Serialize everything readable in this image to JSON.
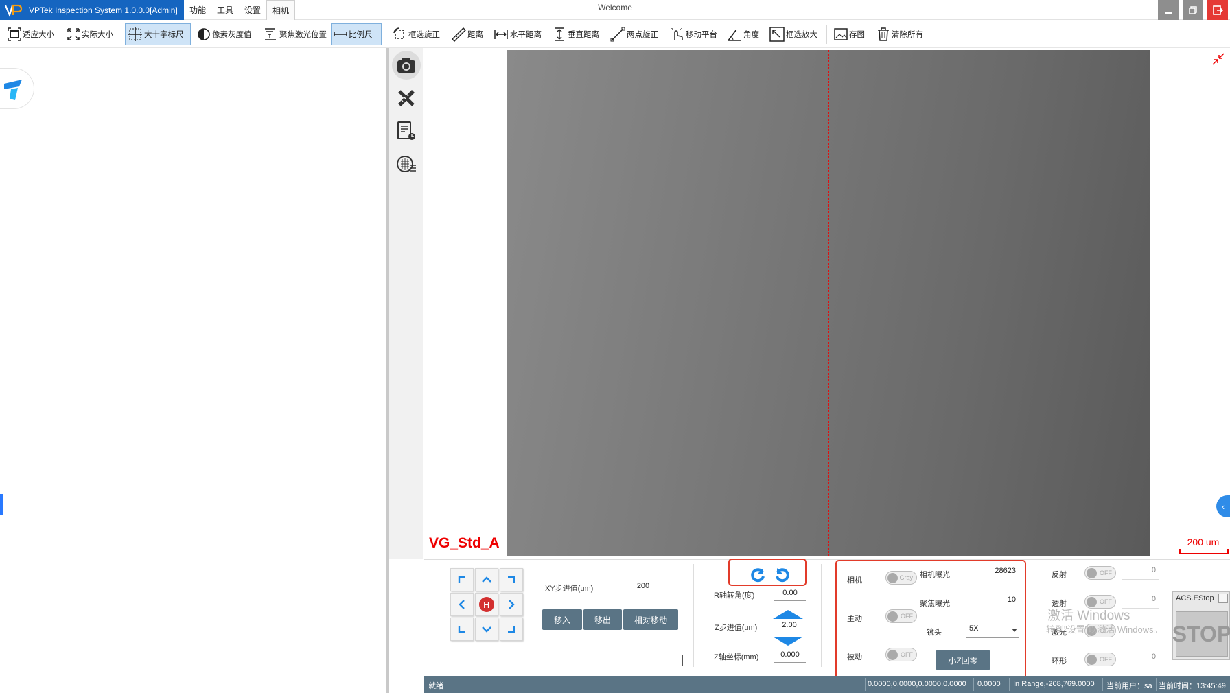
{
  "window": {
    "app_title": "VPTek Inspection System 1.0.0.0[Admin]",
    "window_title": "Welcome",
    "menus": [
      "功能",
      "工具",
      "设置",
      "相机"
    ],
    "selected_menu": "相机"
  },
  "toolbar": {
    "items": [
      {
        "label": "适应大小",
        "icon": "fit-size-icon"
      },
      {
        "label": "实际大小",
        "icon": "actual-size-icon"
      },
      {
        "label": "大十字标尺",
        "icon": "crosshair-icon",
        "active": true
      },
      {
        "label": "像素灰度值",
        "icon": "grayscale-icon"
      },
      {
        "label": "聚焦激光位置",
        "icon": "laser-focus-icon"
      },
      {
        "label": "比例尺",
        "icon": "scale-bar-icon",
        "active": true
      },
      {
        "label": "框选旋正",
        "icon": "box-rotate-icon"
      },
      {
        "label": "距离",
        "icon": "ruler-icon"
      },
      {
        "label": "水平距离",
        "icon": "horizontal-distance-icon"
      },
      {
        "label": "垂直距离",
        "icon": "vertical-distance-icon"
      },
      {
        "label": "两点旋正",
        "icon": "two-point-rotate-icon"
      },
      {
        "label": "移动平台",
        "icon": "move-stage-icon"
      },
      {
        "label": "角度",
        "icon": "angle-icon"
      },
      {
        "label": "框选放大",
        "icon": "box-zoom-icon"
      },
      {
        "label": "存图",
        "icon": "save-image-icon"
      },
      {
        "label": "清除所有",
        "icon": "trash-icon"
      }
    ]
  },
  "viewer": {
    "recipe_label": "VG_Std_A",
    "scale_label": "200 um"
  },
  "motion": {
    "xy_step_label": "XY步进值(um)",
    "xy_step_value": "200",
    "move_in": "移入",
    "move_out": "移出",
    "relative_move": "相对移动",
    "home": "H",
    "r_angle_label": "R轴转角(度)",
    "r_angle_value": "0.00",
    "z_step_label": "Z步进值(um)",
    "z_step_value": "2.00",
    "z_coord_label": "Z轴坐标(mm)",
    "z_coord_value": "0.000"
  },
  "camera": {
    "camera_label": "相机",
    "gray_toggle": "Gray",
    "active_label": "主动",
    "passive_label": "被动",
    "off": "OFF",
    "exposure_label": "相机曝光",
    "exposure_value": "28623",
    "focus_exposure_label": "聚焦曝光",
    "focus_exposure_value": "10",
    "lens_label": "镜头",
    "lens_value": "5X",
    "z_home_button": "小Z回零"
  },
  "lighting": {
    "reflect_label": "反射",
    "reflect_value": "0",
    "transmit_label": "透射",
    "transmit_value": "0",
    "laser_label": "激光",
    "ring_label": "环形",
    "ring_value": "0"
  },
  "estop": {
    "title": "ACS.EStop",
    "button": "STOP"
  },
  "watermark": {
    "line1": "激活 Windows",
    "line2": "转到\"设置\"以激活 Windows。"
  },
  "status": {
    "state": "就绪",
    "coords": "0.0000,0.0000,0.0000,0.0000",
    "value2": "0.0000",
    "range": "In Range,-208,769.0000",
    "user": "当前用户：sa",
    "time": "当前时间：13:45:49"
  },
  "colors": {
    "title_bar": "#1565c0",
    "status_bar": "#5a7485",
    "crosshair": "#e01010",
    "highlight_box": "#e23b2a"
  }
}
